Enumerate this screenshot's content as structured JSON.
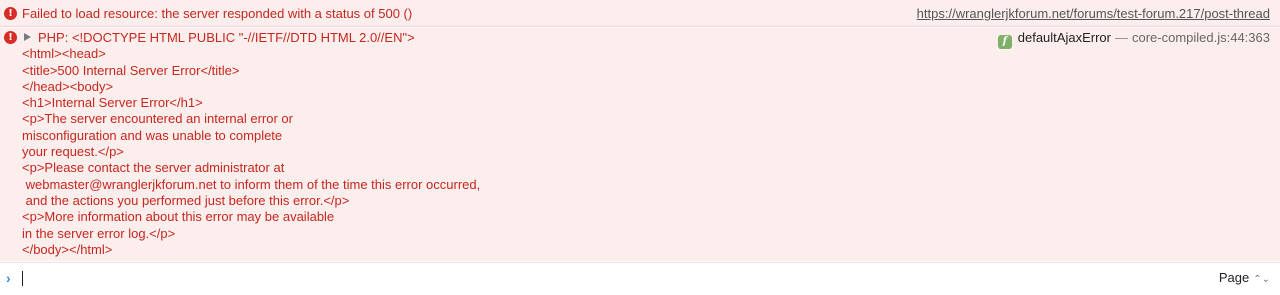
{
  "messages": [
    {
      "type": "error",
      "icon": "error-icon",
      "text": "Failed to load resource: the server responded with a status of 500 ()",
      "source_url": "https://wranglerjkforum.net/forums/test-forum.217/post-thread"
    },
    {
      "type": "error",
      "icon": "error-icon",
      "first_line": "PHP: <!DOCTYPE HTML PUBLIC \"-//IETF//DTD HTML 2.0//EN\">",
      "body": "<html><head>\n<title>500 Internal Server Error</title>\n</head><body>\n<h1>Internal Server Error</h1>\n<p>The server encountered an internal error or\nmisconfiguration and was unable to complete\nyour request.</p>\n<p>Please contact the server administrator at\n webmaster@wranglerjkforum.net to inform them of the time this error occurred,\n and the actions you performed just before this error.</p>\n<p>More information about this error may be available\nin the server error log.</p>\n</body></html>",
      "function_icon": "f",
      "function_name": "defaultAjaxError",
      "separator": "—",
      "source_location": "core-compiled.js:44:363"
    }
  ],
  "prompt": {
    "chevron": "›",
    "value": "",
    "context": "Page",
    "context_arrows": "⌃⌄"
  }
}
